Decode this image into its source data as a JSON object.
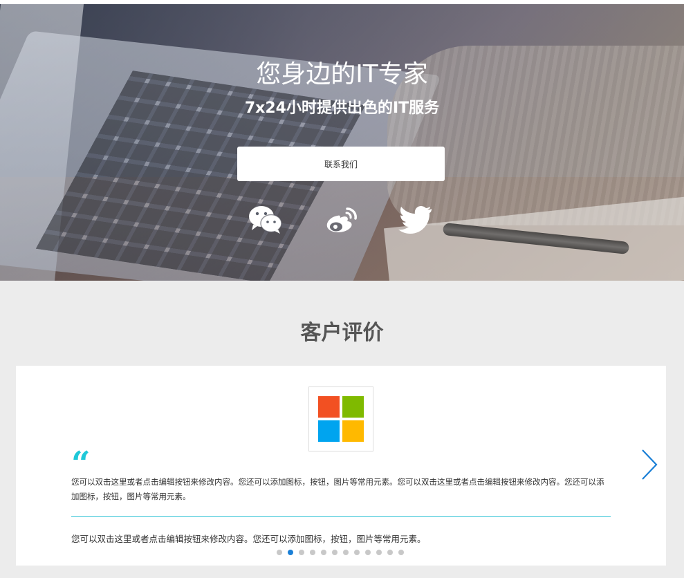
{
  "hero": {
    "title": "您身边的IT专家",
    "subtitle": "7x24小时提供出色的IT服务",
    "contact_button": "联系我们",
    "social_icons": [
      "wechat-icon",
      "weibo-icon",
      "twitter-icon"
    ]
  },
  "reviews": {
    "section_title": "客户评价",
    "logo": "microsoft-logo",
    "quote_mark": "“",
    "quote_text": "您可以双击这里或者点击编辑按钮来修改内容。您还可以添加图标，按钮，图片等常用元素。您可以双击这里或者点击编辑按钮来修改内容。您还可以添加图标，按钮，图片等常用元素。",
    "author_text": "您可以双击这里或者点击编辑按钮来修改内容。您还可以添加图标，按钮，图片等常用元素。",
    "dot_count": 12,
    "active_dot": 2
  },
  "colors": {
    "accent": "#1ec8d8",
    "arrow": "#1a7fd6",
    "active_dot": "#1a7fd6",
    "background": "#ececec"
  }
}
